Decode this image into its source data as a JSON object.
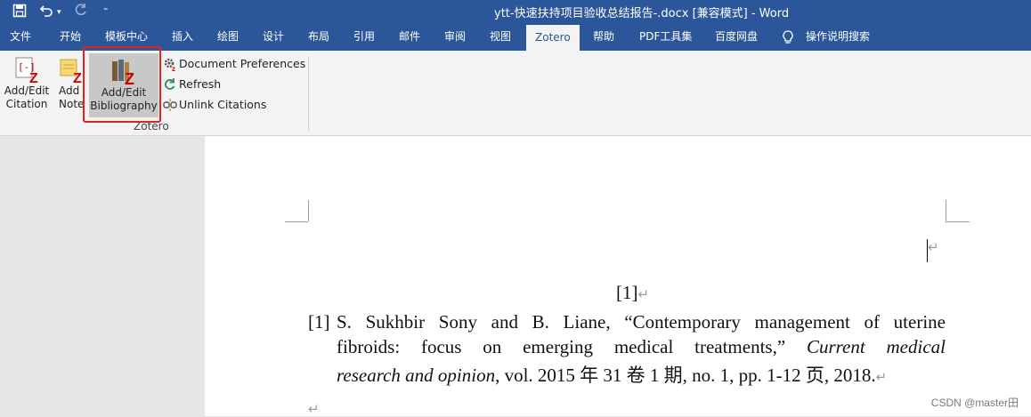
{
  "window": {
    "title": "ytt-快速扶持项目验收总结报告-.docx [兼容模式]  -  Word"
  },
  "quick_access": {
    "save_icon": "save-icon",
    "undo_icon": "undo-icon",
    "redo_icon": "redo-icon",
    "customize_icon": "customize-icon"
  },
  "tabs": [
    {
      "label": "文件"
    },
    {
      "label": "开始"
    },
    {
      "label": "模板中心"
    },
    {
      "label": "插入"
    },
    {
      "label": "绘图"
    },
    {
      "label": "设计"
    },
    {
      "label": "布局"
    },
    {
      "label": "引用"
    },
    {
      "label": "邮件"
    },
    {
      "label": "审阅"
    },
    {
      "label": "视图"
    },
    {
      "label": "Zotero",
      "active": true
    },
    {
      "label": "帮助"
    },
    {
      "label": "PDF工具集"
    },
    {
      "label": "百度网盘"
    },
    {
      "label": "操作说明搜索"
    }
  ],
  "ribbon": {
    "add_edit_citation": "Add/Edit\nCitation",
    "add_note": "Add\nNote",
    "add_edit_bibliography": "Add/Edit\nBibliography",
    "document_preferences": "Document Preferences",
    "refresh": "Refresh",
    "unlink_citations": "Unlink Citations",
    "group_label": "Zotero"
  },
  "document": {
    "citation_marker": "[1]",
    "reference_number": "[1]",
    "line1": "S. Sukhbir Sony and B. Liane, “Contemporary management of uterine",
    "line2a": "fibroids: focus on emerging medical treatments,” ",
    "line2b": "Current medical",
    "line3a": "research and opinion",
    "line3b": ", vol. 2015 年 31 卷 1 期, no. 1, pp. 1-12 页, 2018."
  },
  "watermark": "CSDN @master田",
  "colors": {
    "title_bar": "#2b579a",
    "ribbon": "#f3f3f3",
    "highlight_box": "#e0231c"
  }
}
